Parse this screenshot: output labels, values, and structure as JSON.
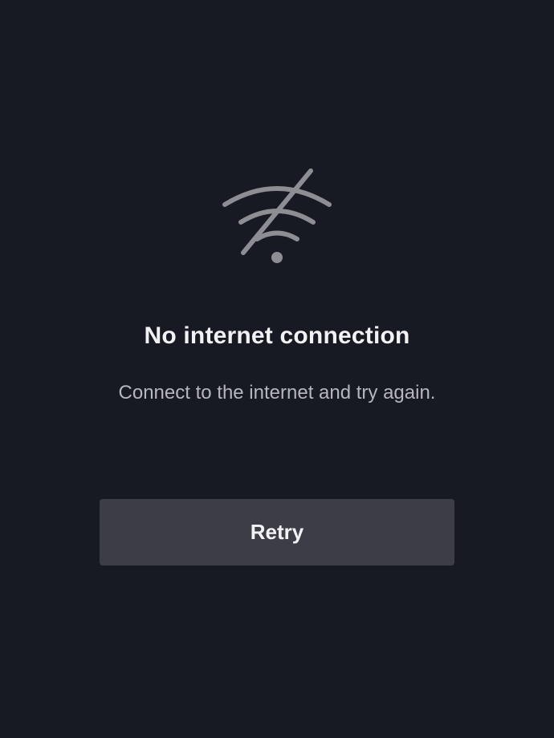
{
  "icon": "wifi-off-icon",
  "title": "No internet connection",
  "subtitle": "Connect to the internet and try again.",
  "retry_label": "Retry",
  "colors": {
    "background": "#171923",
    "icon": "#8d8e93",
    "title": "#f2f2f4",
    "subtitle": "#b6b7bd",
    "button_bg": "#3c3d46",
    "button_text": "#f2f2f4"
  }
}
